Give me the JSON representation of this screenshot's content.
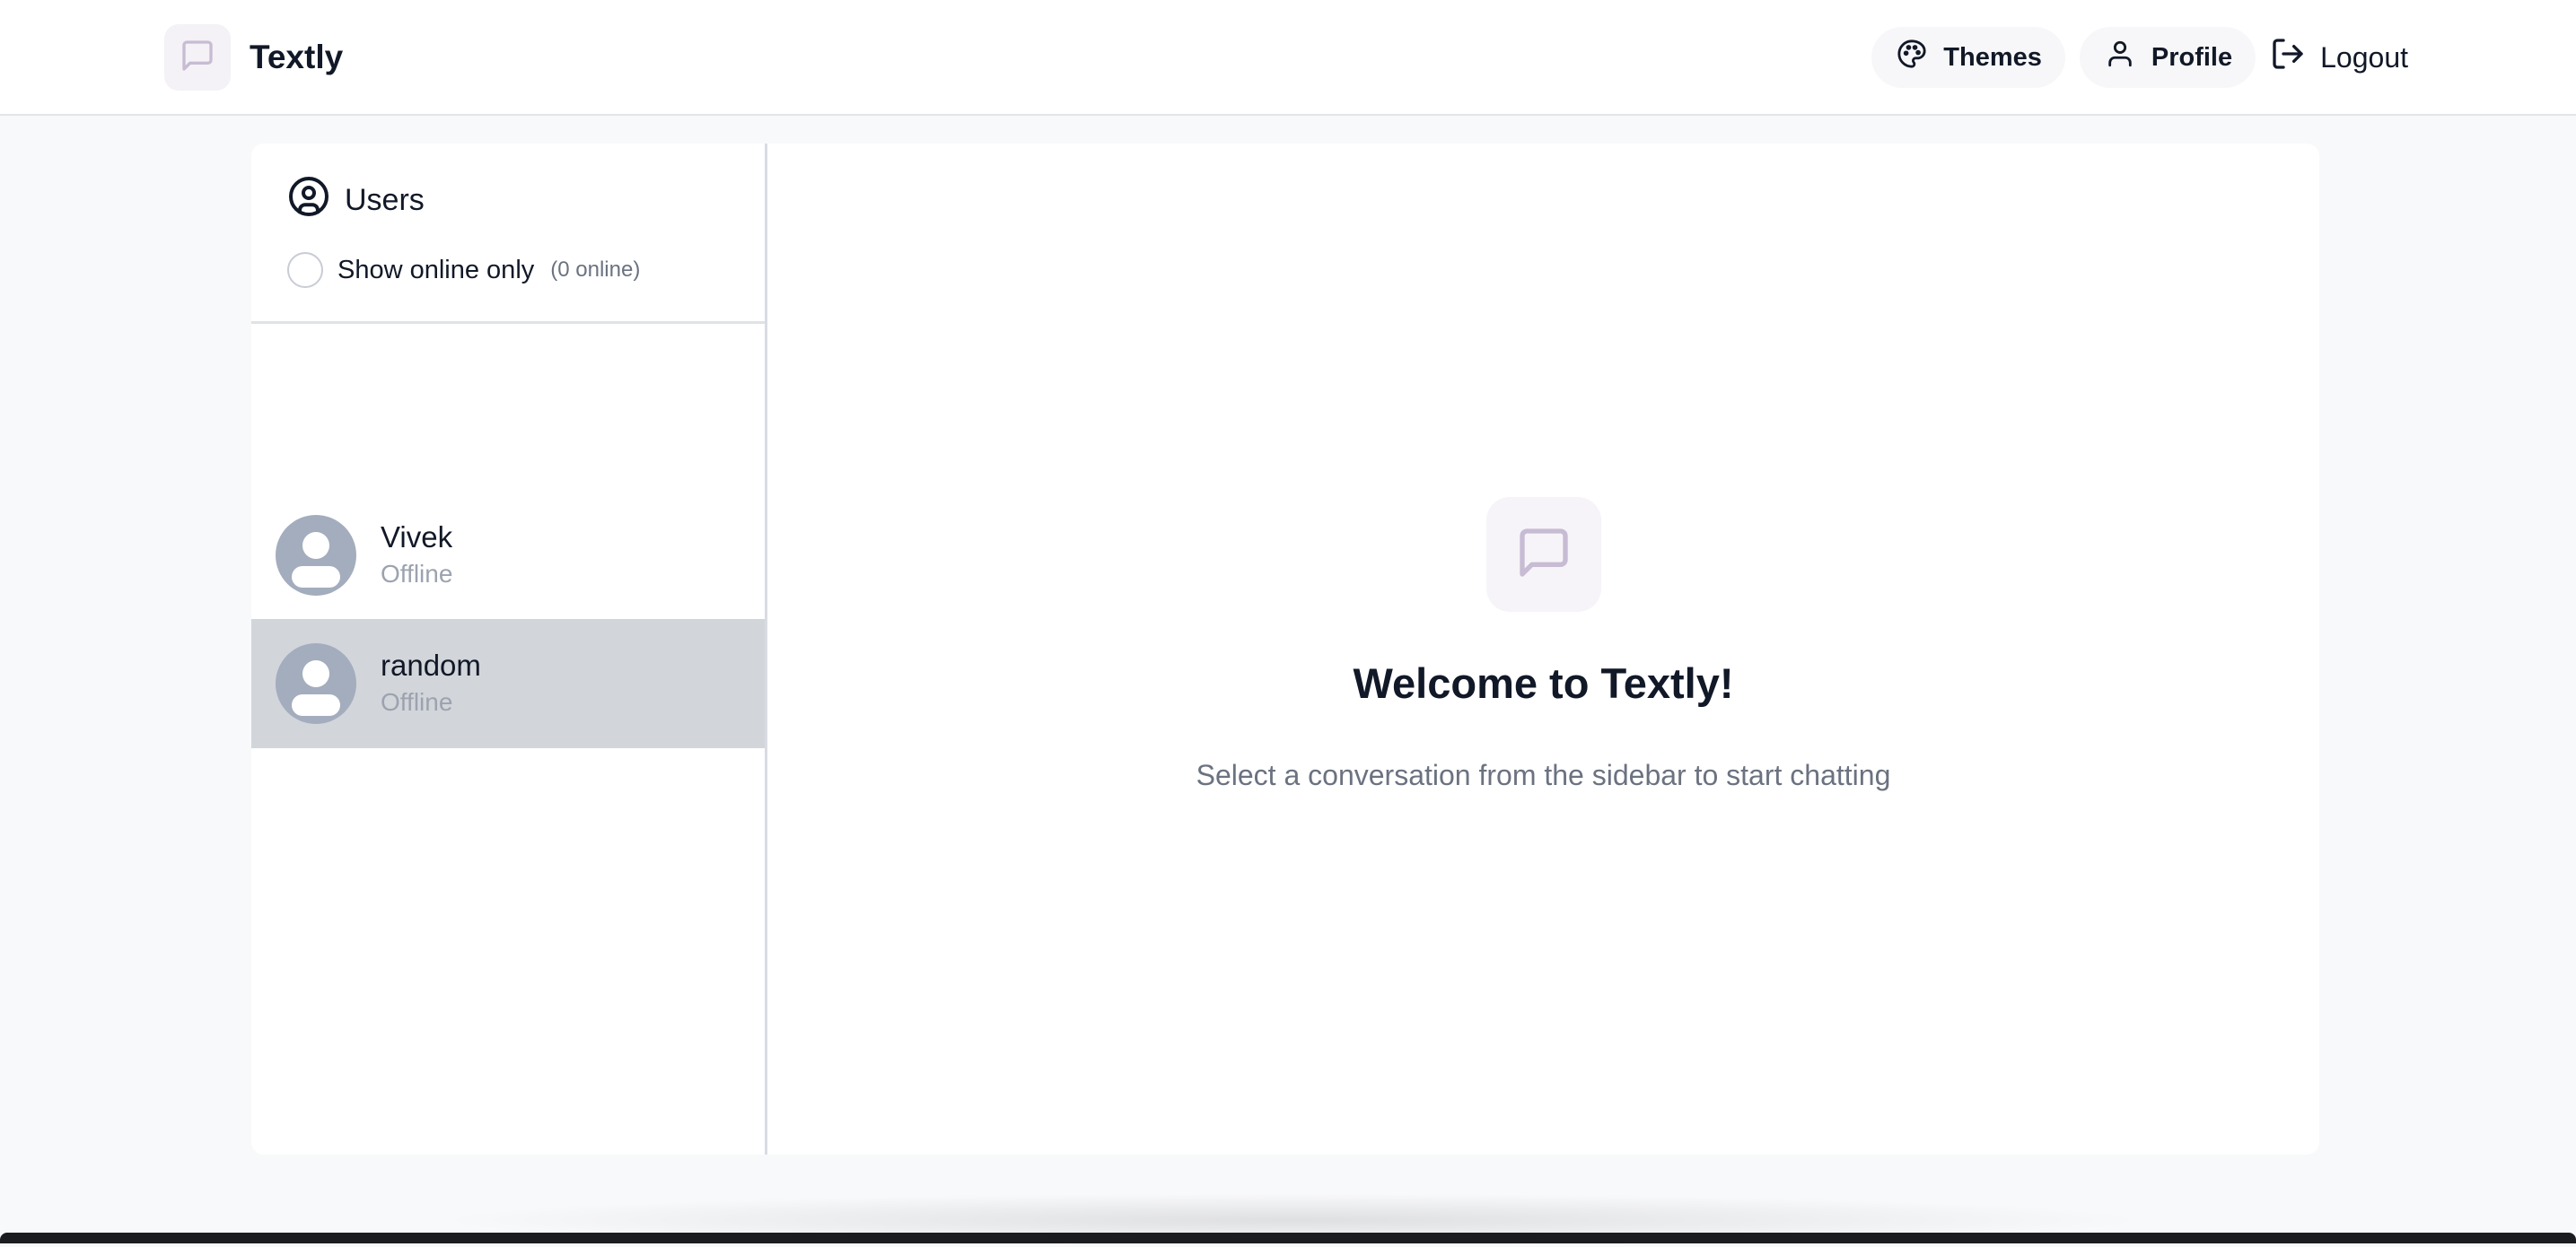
{
  "app": {
    "name": "Textly"
  },
  "navbar": {
    "themes_label": "Themes",
    "profile_label": "Profile",
    "logout_label": "Logout"
  },
  "sidebar": {
    "title": "Users",
    "filter_label": "Show online only",
    "online_count": "(0 online)",
    "filter_checked": false,
    "users": [
      {
        "name": "Vivek",
        "status": "Offline",
        "selected": false
      },
      {
        "name": "random",
        "status": "Offline",
        "selected": true
      }
    ]
  },
  "welcome": {
    "title": "Welcome to Textly!",
    "subtitle": "Select a conversation from the sidebar to start chatting"
  },
  "colors": {
    "accent_icon": "#c7bcd3",
    "selected_row": "#d2d5da",
    "avatar_bg": "#a3adbd"
  },
  "icons": {
    "brand": "message-square-icon",
    "themes": "palette-icon",
    "profile": "user-icon",
    "logout": "logout-icon",
    "users": "user-circle-icon",
    "welcome": "message-square-icon"
  }
}
